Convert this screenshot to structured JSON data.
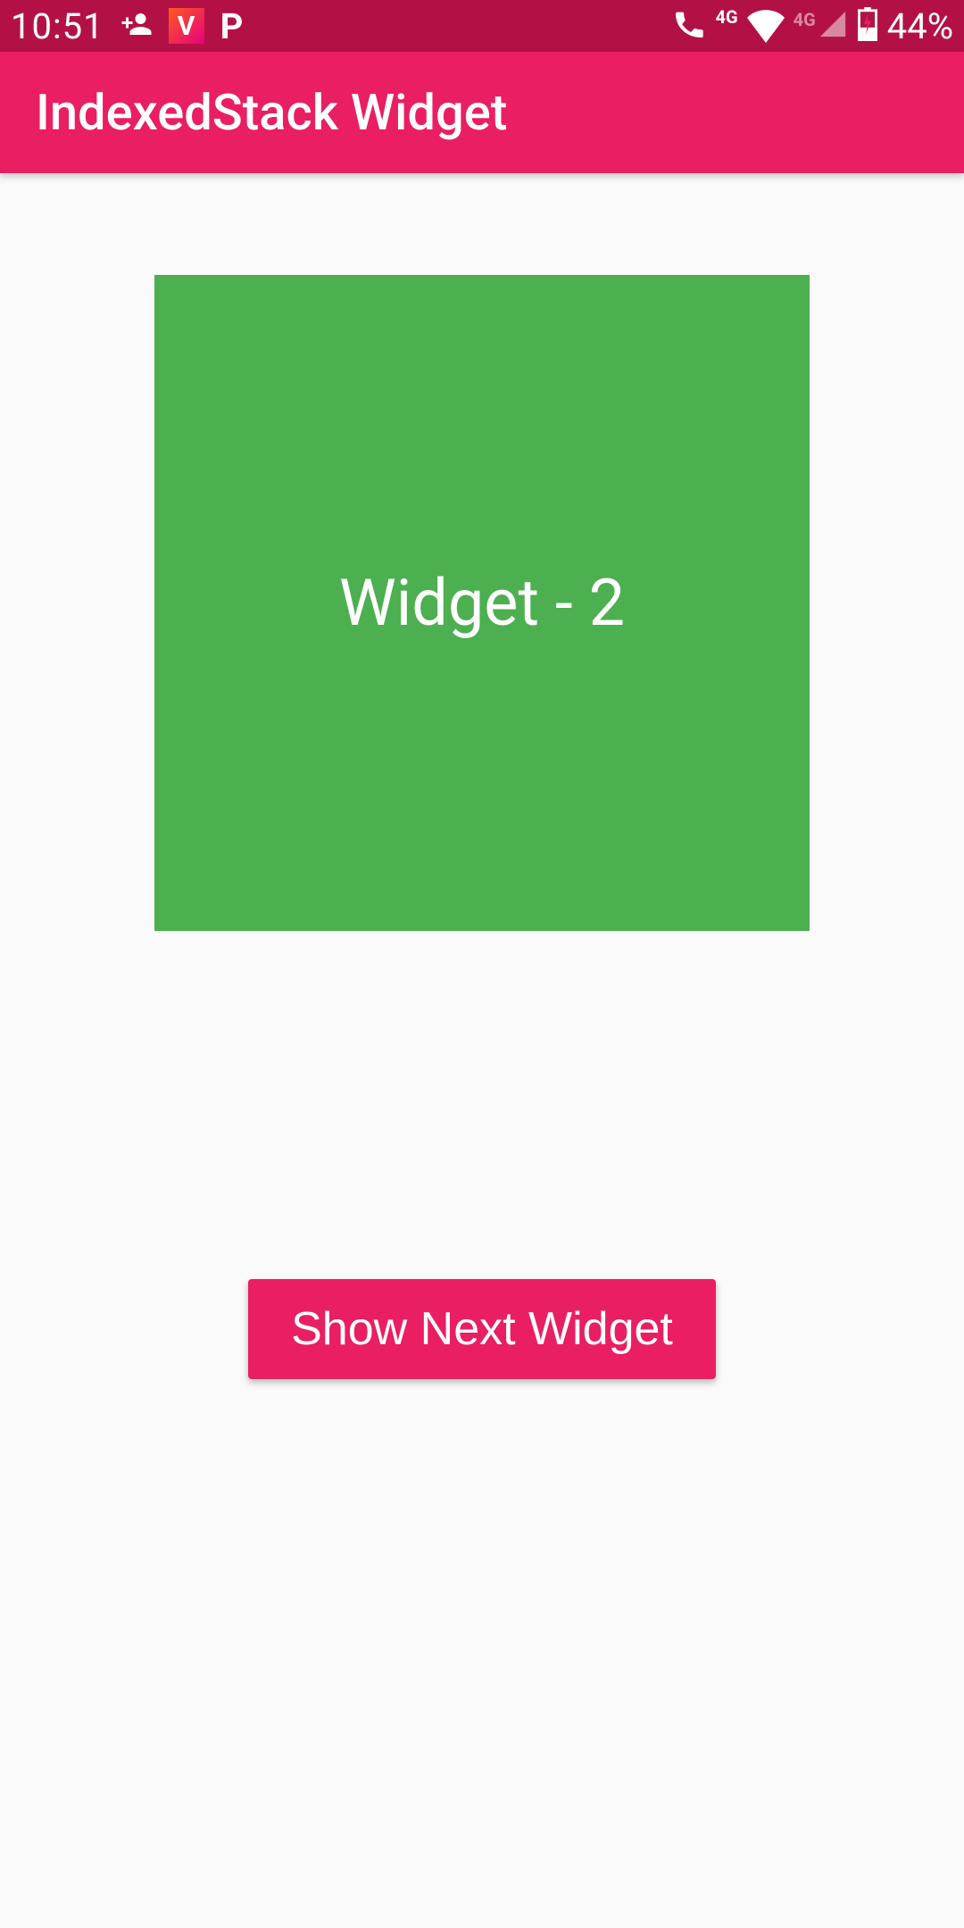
{
  "status_bar": {
    "time": "10:51",
    "battery_text": "44%",
    "icons": {
      "person_add": "person-add-icon",
      "v_app": "V",
      "p_app": "P",
      "phone_4g": "4G",
      "wifi": "wifi-icon",
      "signal_4g": "4G",
      "battery": "battery-icon"
    }
  },
  "app_bar": {
    "title": "IndexedStack Widget"
  },
  "main": {
    "widget_label": "Widget - 2",
    "widget_color": "#4caf50",
    "button_label": "Show Next Widget"
  },
  "colors": {
    "status_bar_bg": "#b31145",
    "app_bar_bg": "#e91e63",
    "button_bg": "#e91e63"
  }
}
